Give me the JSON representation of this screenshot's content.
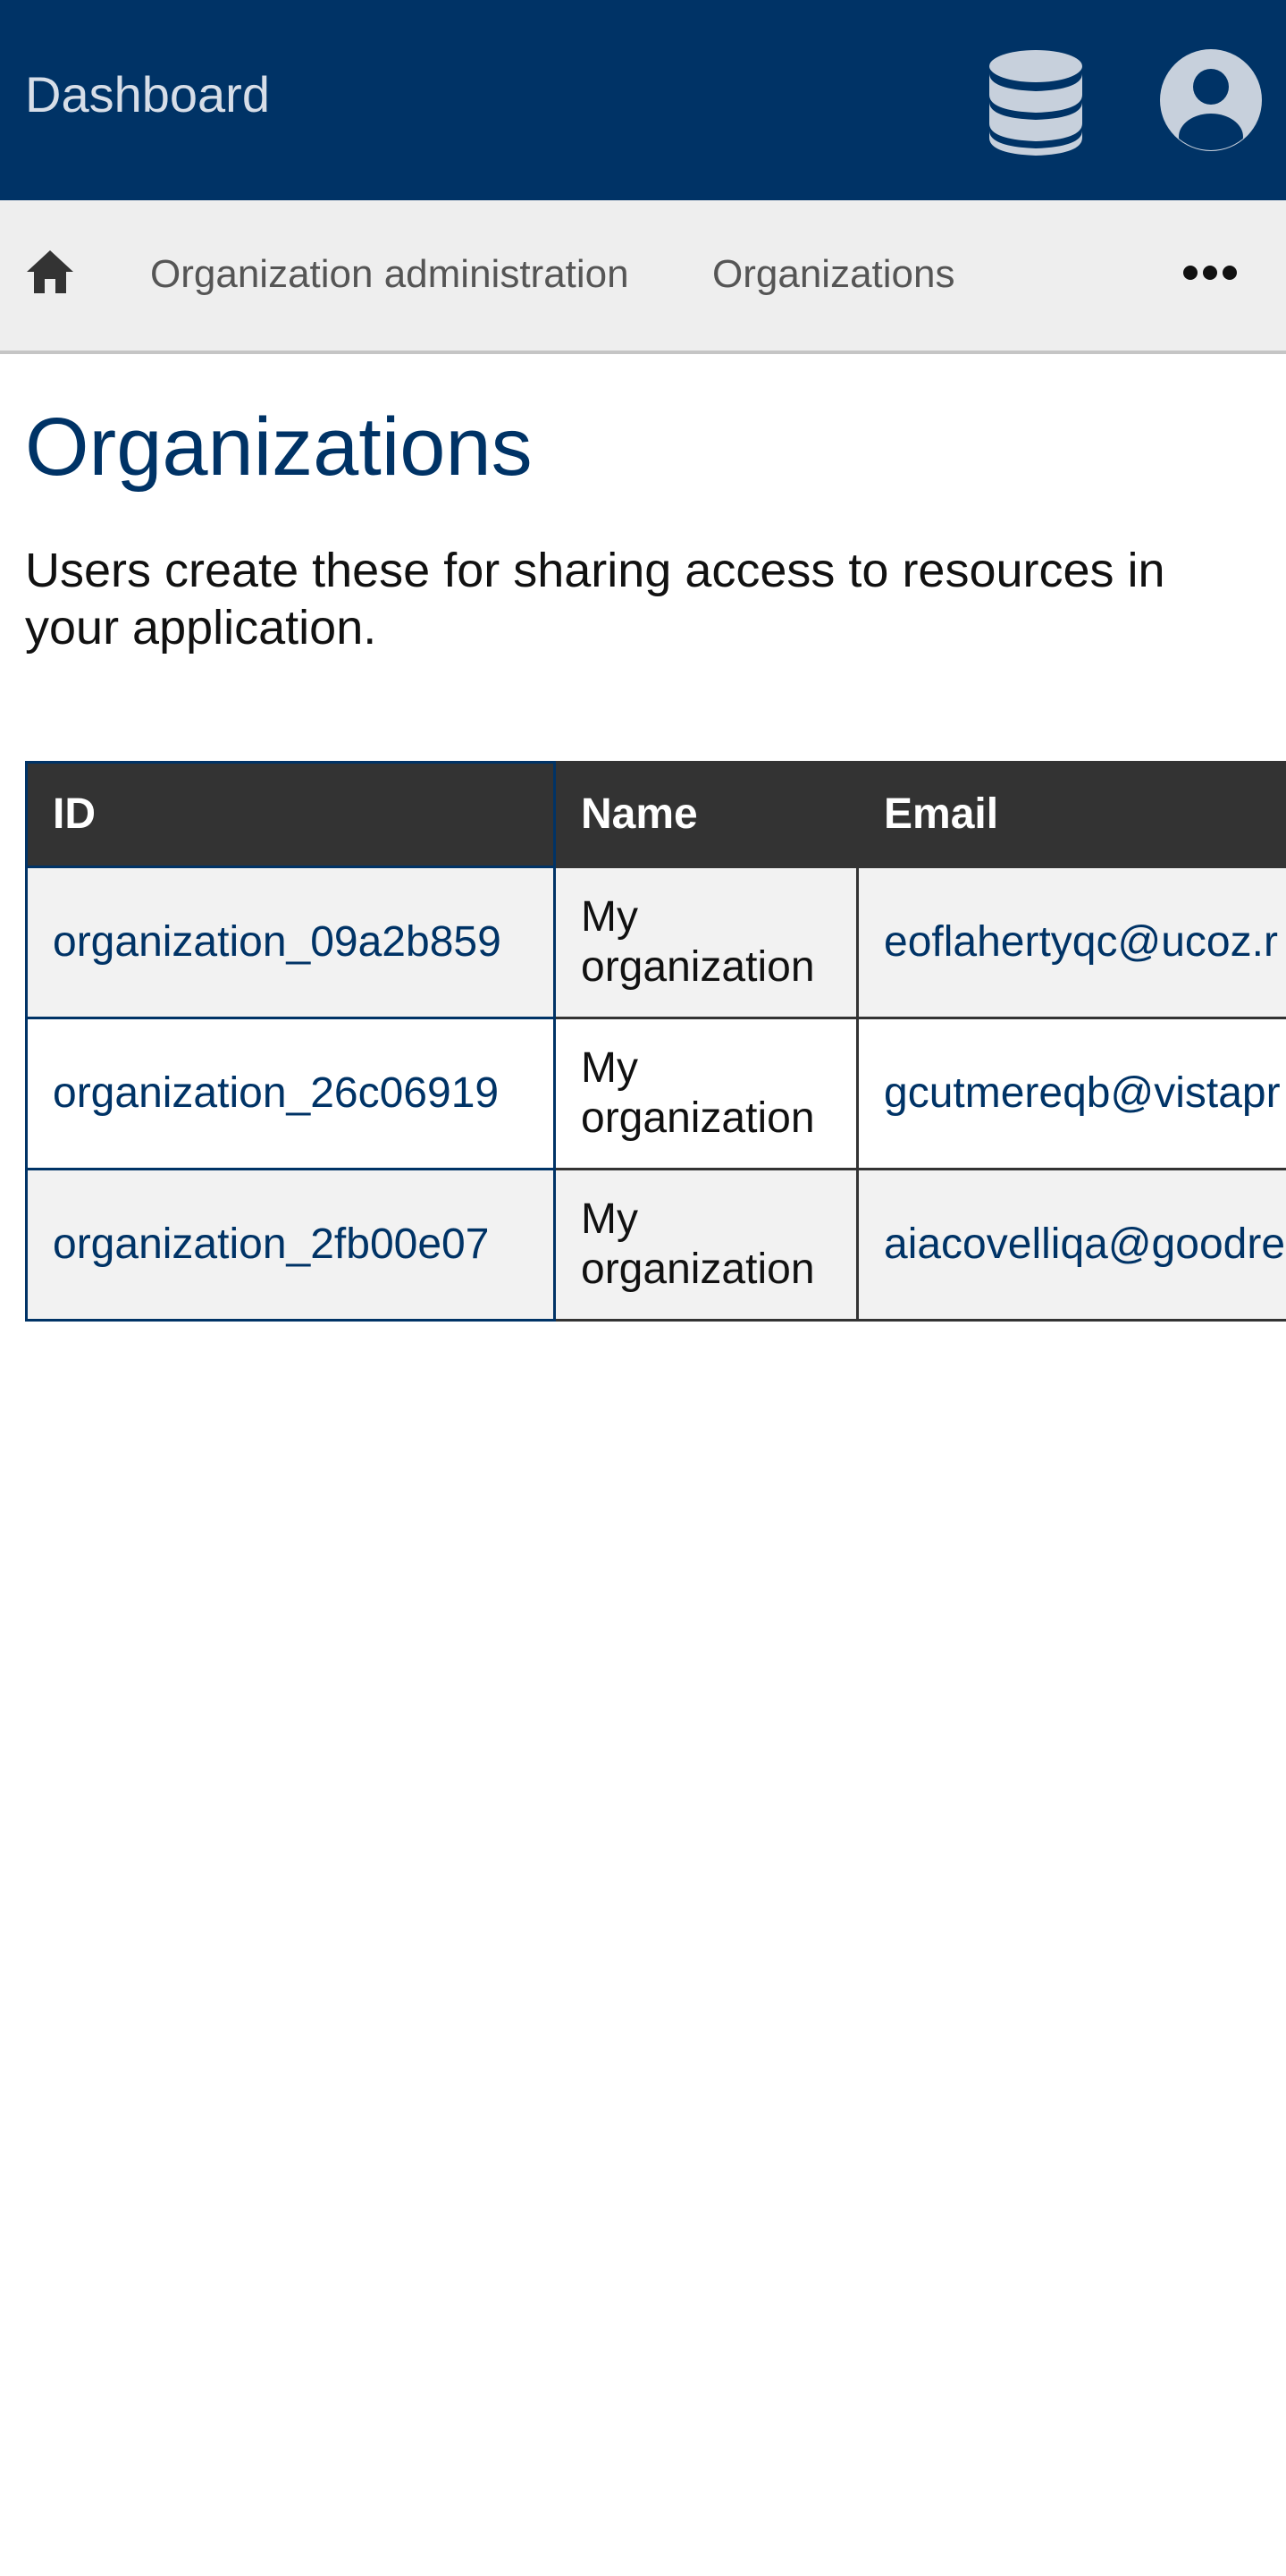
{
  "header": {
    "app_title": "Dashboard",
    "icons": [
      "database-icon",
      "user-avatar-icon"
    ],
    "background_color": "#003366"
  },
  "breadcrumb": {
    "home_icon": "home-icon",
    "items": [
      {
        "label": "Organization administration"
      },
      {
        "label": "Organizations"
      }
    ],
    "more_icon": "more-horizontal-icon"
  },
  "page": {
    "title": "Organizations",
    "description": "Users create these for sharing access to resources in your application."
  },
  "table": {
    "columns": [
      "ID",
      "Name",
      "Email"
    ],
    "rows": [
      {
        "id": "organization_09a2b859",
        "name": "My organization",
        "email": "eoflahertyqc@ucoz.r"
      },
      {
        "id": "organization_26c06919",
        "name": "My organization",
        "email": "gcutmereqb@vistapr"
      },
      {
        "id": "organization_2fb00e07",
        "name": "My organization",
        "email": "aiacovelliqa@goodre"
      }
    ]
  },
  "colors": {
    "primary": "#003366",
    "table_header": "#333333",
    "breadcrumb_background": "#eeeeee"
  }
}
